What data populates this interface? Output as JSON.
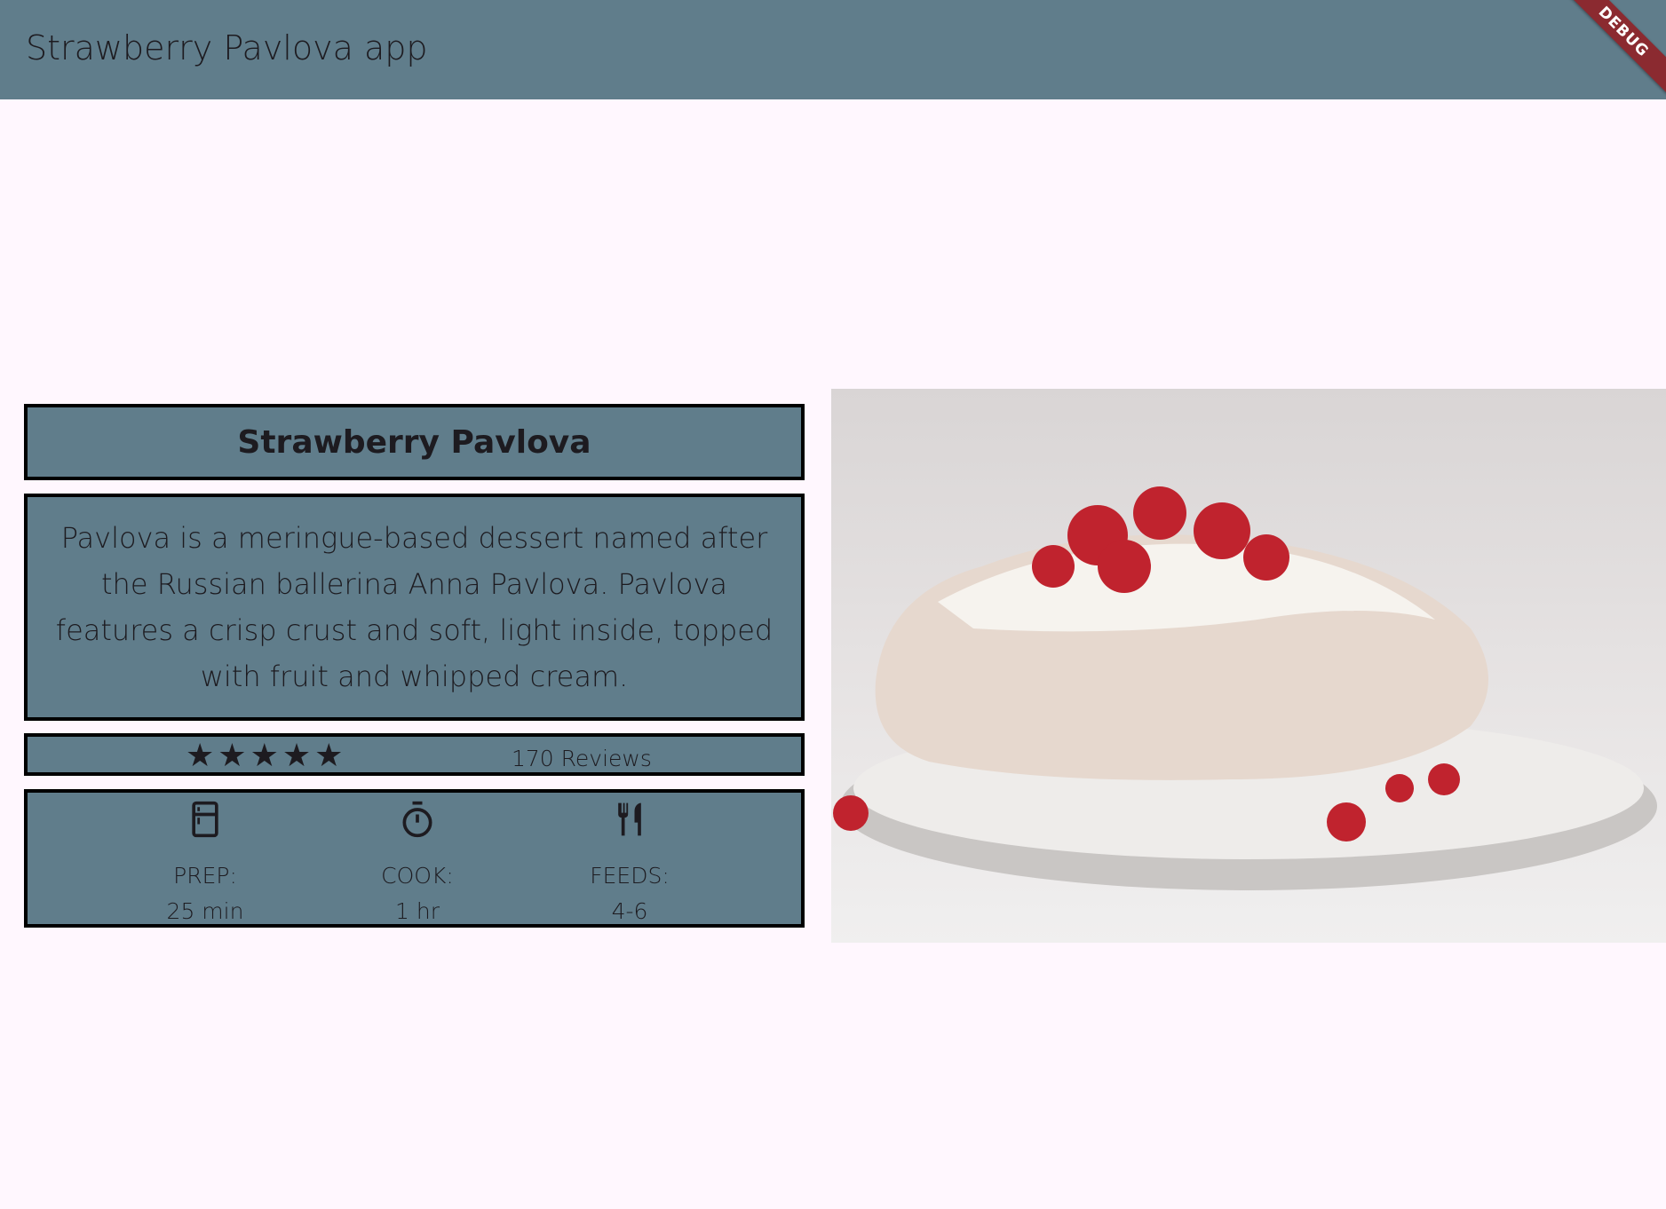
{
  "app_bar": {
    "title": "Strawberry Pavlova app",
    "debug_banner": "DEBUG"
  },
  "recipe": {
    "title": "Strawberry Pavlova",
    "description": "Pavlova is a meringue-based dessert named after the Russian ballerina Anna Pavlova. Pavlova features a crisp crust and soft, light inside, topped with fruit and whipped cream.",
    "rating": {
      "stars": 5,
      "max": 5,
      "star_glyph": "★",
      "reviews": "170 Reviews"
    },
    "info": [
      {
        "icon": "kitchen-icon",
        "label": "PREP:",
        "value": "25 min"
      },
      {
        "icon": "timer-icon",
        "label": "COOK:",
        "value": "1 hr"
      },
      {
        "icon": "restaurant-icon",
        "label": "FEEDS:",
        "value": "4-6"
      }
    ]
  },
  "colors": {
    "app_bar": "#607d8b",
    "background": "#fff7fe",
    "debug": "#8b2a30"
  }
}
